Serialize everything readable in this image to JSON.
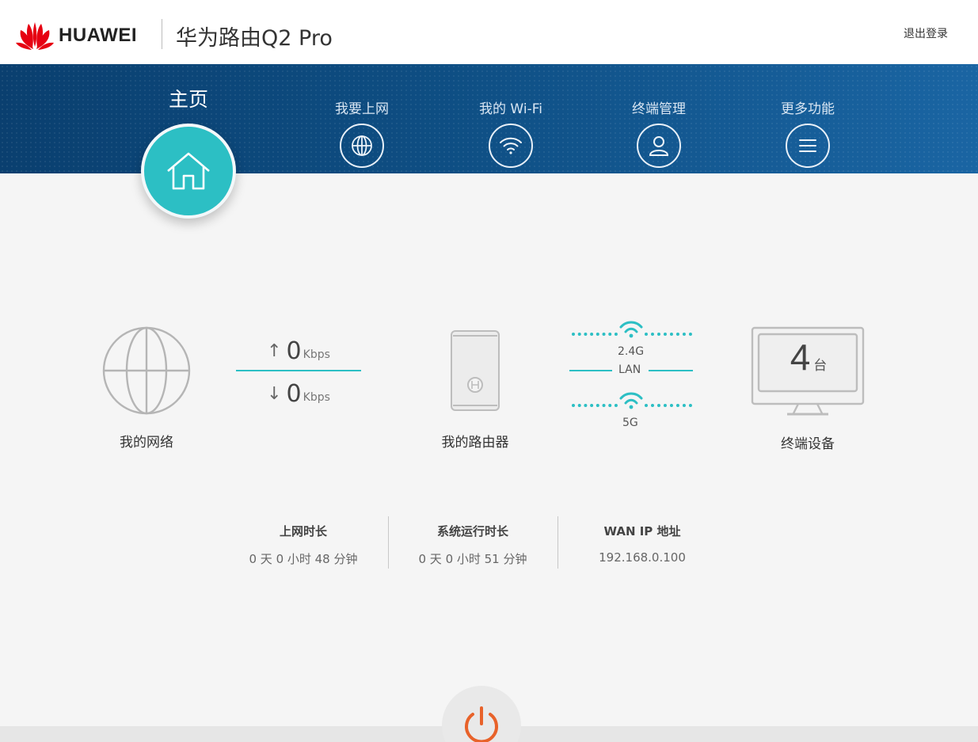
{
  "header": {
    "brand": "HUAWEI",
    "product_title": "华为路由Q2 Pro",
    "logout_label": "退出登录"
  },
  "nav": {
    "home": {
      "label": "主页",
      "icon": "home-icon"
    },
    "items": [
      {
        "label": "我要上网",
        "icon": "globe-icon"
      },
      {
        "label": "我的 Wi-Fi",
        "icon": "wifi-icon"
      },
      {
        "label": "终端管理",
        "icon": "user-icon"
      },
      {
        "label": "更多功能",
        "icon": "menu-icon"
      }
    ]
  },
  "topology": {
    "network_label": "我的网络",
    "upload": {
      "value": "0",
      "unit": "Kbps"
    },
    "download": {
      "value": "0",
      "unit": "Kbps"
    },
    "router_label": "我的路由器",
    "band_24g": "2.4G",
    "lan": "LAN",
    "band_5g": "5G",
    "devices_count": "4",
    "devices_unit": "台",
    "devices_label": "终端设备"
  },
  "stats": [
    {
      "title": "上网时长",
      "value": "0 天 0 小时 48 分钟"
    },
    {
      "title": "系统运行时长",
      "value": "0 天 0 小时 51 分钟"
    },
    {
      "title": "WAN IP 地址",
      "value": "192.168.0.100"
    }
  ],
  "colors": {
    "accent": "#2cbfc4",
    "nav_bg": "#0e4e83",
    "power": "#e8622a",
    "brand_red": "#e60012"
  }
}
